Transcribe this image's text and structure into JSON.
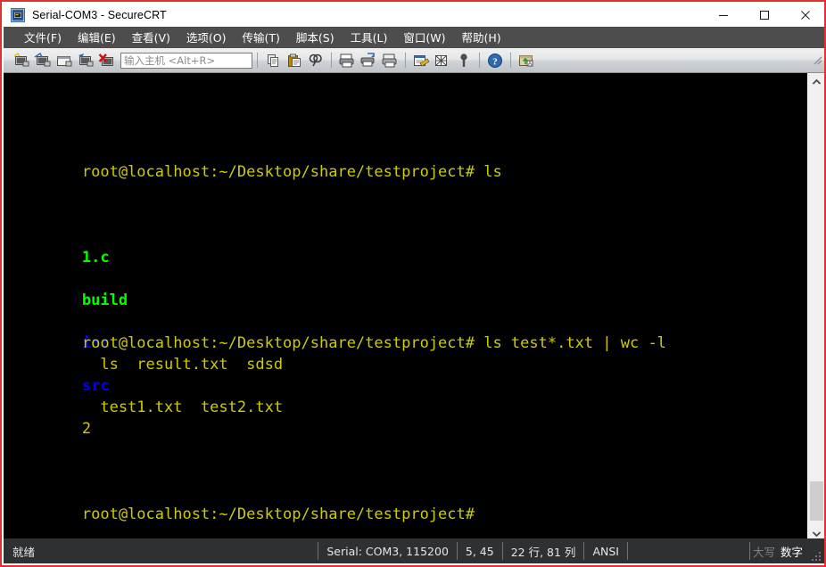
{
  "window": {
    "title": "Serial-COM3 - SecureCRT",
    "icon": "securecrt-app-icon",
    "controls": {
      "minimize": "minimize-icon",
      "maximize": "maximize-icon",
      "close": "close-icon"
    }
  },
  "menu": {
    "items": [
      {
        "label": "文件(F)",
        "name": "menu-file"
      },
      {
        "label": "编辑(E)",
        "name": "menu-edit"
      },
      {
        "label": "查看(V)",
        "name": "menu-view"
      },
      {
        "label": "选项(O)",
        "name": "menu-options"
      },
      {
        "label": "传输(T)",
        "name": "menu-transfer"
      },
      {
        "label": "脚本(S)",
        "name": "menu-script"
      },
      {
        "label": "工具(L)",
        "name": "menu-tools"
      },
      {
        "label": "窗口(W)",
        "name": "menu-window"
      },
      {
        "label": "帮助(H)",
        "name": "menu-help"
      }
    ]
  },
  "toolbar": {
    "host_placeholder": "输入主机 <Alt+R>",
    "host_value": "",
    "buttons": [
      "new-session-icon",
      "clone-session-icon",
      "new-tab-icon",
      "connect-icon",
      "disconnect-icon",
      "copy-icon",
      "paste-icon",
      "find-icon",
      "print-icon",
      "log-session-icon",
      "print-screen-icon",
      "session-options-icon",
      "global-options-icon",
      "key-icon",
      "help-icon",
      "upload-download-icon"
    ]
  },
  "terminal": {
    "lines": [
      [
        {
          "text": "root@localhost:~/Desktop/share/testproject# ls",
          "color": "yellow"
        }
      ],
      [
        {
          "text": "1.c",
          "color": "green"
        },
        {
          "text": "  ",
          "color": "yellow"
        },
        {
          "text": "build",
          "color": "green"
        },
        {
          "text": "  ",
          "color": "yellow"
        },
        {
          "text": "inc",
          "color": "blue"
        },
        {
          "text": "  ls  result.txt  sdsd  ",
          "color": "yellow"
        },
        {
          "text": "src",
          "color": "blue"
        },
        {
          "text": "  test1.txt  test2.txt",
          "color": "yellow"
        }
      ],
      [
        {
          "text": "root@localhost:~/Desktop/share/testproject# ls test*.txt | wc -l",
          "color": "yellow"
        }
      ],
      [
        {
          "text": "2",
          "color": "yellow"
        }
      ],
      [
        {
          "text": "root@localhost:~/Desktop/share/testproject#",
          "color": "yellow"
        }
      ]
    ],
    "colors": {
      "background": "#000000",
      "yellow": "#cdcd00",
      "green": "#00ff00",
      "blue": "#0000ee"
    },
    "scrollbar": {
      "up_arrow": "chevron-up-icon",
      "down_arrow": "chevron-down-icon"
    }
  },
  "status": {
    "ready": "就绪",
    "connection": "Serial: COM3, 115200",
    "cursor": "5, 45",
    "size": "22 行, 81 列",
    "encoding": "ANSI",
    "blank": "",
    "caps": "大写",
    "num": "数字"
  }
}
